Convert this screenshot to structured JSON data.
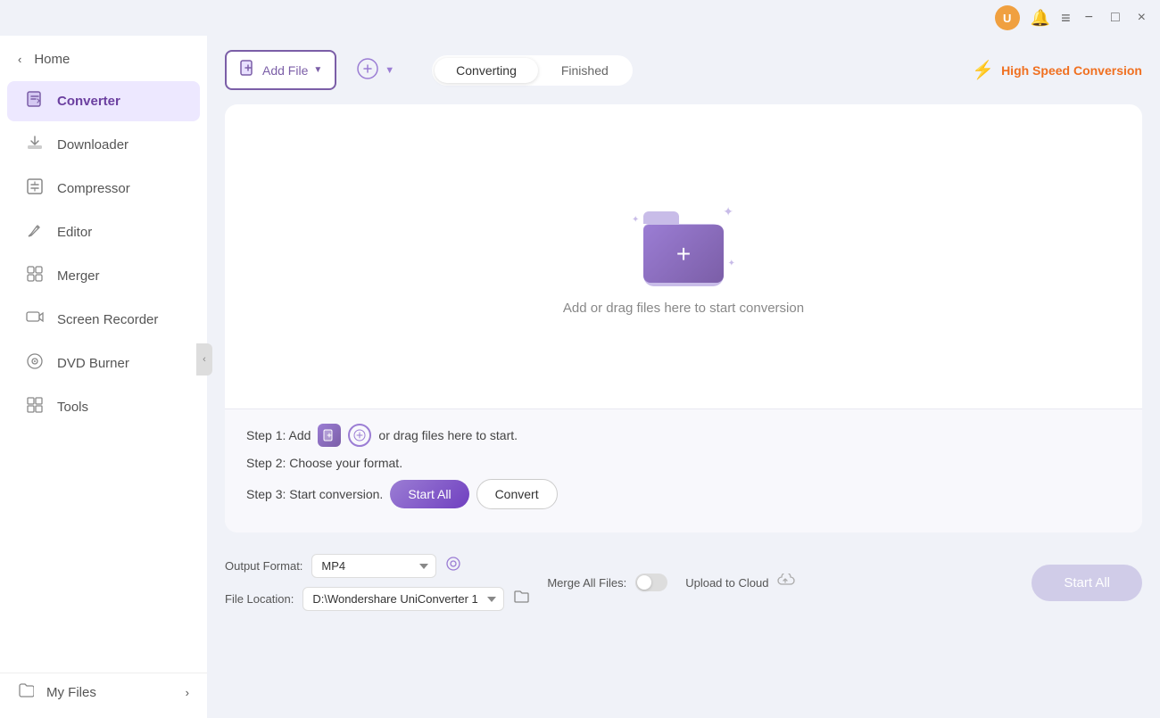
{
  "titlebar": {
    "avatar_initial": "U",
    "minimize_label": "−",
    "maximize_label": "□",
    "close_label": "×"
  },
  "sidebar": {
    "home_label": "Home",
    "items": [
      {
        "id": "converter",
        "label": "Converter",
        "icon": "🖥"
      },
      {
        "id": "downloader",
        "label": "Downloader",
        "icon": "⬇"
      },
      {
        "id": "compressor",
        "label": "Compressor",
        "icon": "🗜"
      },
      {
        "id": "editor",
        "label": "Editor",
        "icon": "✂"
      },
      {
        "id": "merger",
        "label": "Merger",
        "icon": "⊞"
      },
      {
        "id": "screen-recorder",
        "label": "Screen Recorder",
        "icon": "🎬"
      },
      {
        "id": "dvd-burner",
        "label": "DVD Burner",
        "icon": "💿"
      },
      {
        "id": "tools",
        "label": "Tools",
        "icon": "⚙"
      }
    ],
    "my_files_label": "My Files"
  },
  "toolbar": {
    "add_file_label": "Add File",
    "add_url_label": "",
    "converting_tab": "Converting",
    "finished_tab": "Finished",
    "high_speed_label": "High Speed Conversion"
  },
  "drop_zone": {
    "drop_text": "Add or drag files here to start conversion",
    "step1_text": "Step 1: Add",
    "step1_suffix": "or drag files here to start.",
    "step2_text": "Step 2: Choose your format.",
    "step3_text": "Step 3: Start conversion.",
    "start_all_label": "Start All",
    "convert_label": "Convert"
  },
  "bottom_bar": {
    "output_format_label": "Output Format:",
    "format_value": "MP4",
    "file_location_label": "File Location:",
    "location_value": "D:\\Wondershare UniConverter 1",
    "merge_all_label": "Merge All Files:",
    "upload_cloud_label": "Upload to Cloud",
    "start_all_label": "Start All"
  }
}
